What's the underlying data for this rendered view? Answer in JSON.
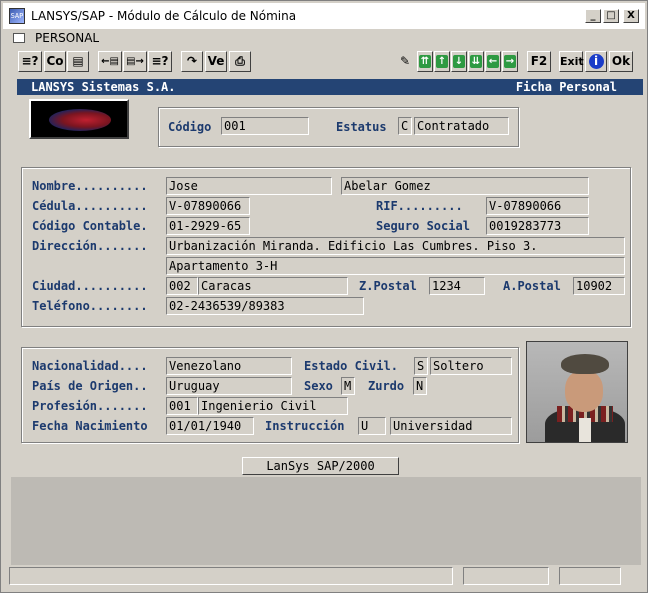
{
  "window": {
    "title": "LANSYS/SAP - Módulo de Cálculo de Nómina",
    "app_icon_text": "SAP",
    "minimize": "_",
    "maximize": "□",
    "close": "X"
  },
  "menubar": {
    "label": "PERSONAL"
  },
  "toolbar": {
    "left_buttons": [
      {
        "name": "list-icon",
        "label": "≡?"
      },
      {
        "name": "copy-button",
        "label": "Co"
      },
      {
        "name": "folder-icon",
        "label": "▤"
      },
      {
        "name": "import-icon",
        "label": "←▤"
      },
      {
        "name": "export-icon",
        "label": "▤→"
      },
      {
        "name": "report-icon",
        "label": "≡?"
      },
      {
        "name": "forward-icon",
        "label": "↷"
      },
      {
        "name": "view-button",
        "label": "Ve"
      },
      {
        "name": "print-icon",
        "label": "⎙"
      }
    ],
    "right_buttons": [
      {
        "name": "clear-icon",
        "label": "✎"
      },
      {
        "name": "first-icon",
        "label": "⇈"
      },
      {
        "name": "up-icon",
        "label": "↑"
      },
      {
        "name": "down-icon",
        "label": "↓"
      },
      {
        "name": "last-icon",
        "label": "⇊"
      },
      {
        "name": "prev-icon",
        "label": "←"
      },
      {
        "name": "next-icon",
        "label": "→"
      }
    ],
    "f2": "F2",
    "exit": "Exit",
    "info": "i",
    "ok": "Ok"
  },
  "strip": {
    "company": "LANSYS Sistemas S.A.",
    "section": "Ficha Personal"
  },
  "header": {
    "codigo_label": "Código",
    "codigo": "001",
    "estatus_label": "Estatus",
    "estatus_code": "C",
    "estatus_text": "Contratado"
  },
  "personal": {
    "nombre_label": "Nombre..........",
    "nombre": "Jose",
    "apellido": "Abelar Gomez",
    "cedula_label": "Cédula..........",
    "cedula": "V-07890066",
    "rif_label": "RIF.........",
    "rif": "V-07890066",
    "codigo_contable_label": "Código Contable.",
    "codigo_contable": "01-2929-65",
    "seguro_label": "Seguro Social",
    "seguro": "0019283773",
    "direccion_label": "Dirección.......",
    "direccion1": "Urbanización Miranda. Edificio Las Cumbres. Piso 3.",
    "direccion2": "Apartamento 3-H",
    "ciudad_label": "Ciudad..........",
    "ciudad_code": "002",
    "ciudad": "Caracas",
    "zpostal_label": "Z.Postal",
    "zpostal": "1234",
    "apostal_label": "A.Postal",
    "apostal": "10902",
    "telefono_label": "Teléfono........",
    "telefono": "02-2436539/89383"
  },
  "details": {
    "nacionalidad_label": "Nacionalidad....",
    "nacionalidad": "Venezolano",
    "estado_civil_label": "Estado Civil.",
    "estado_civil_code": "S",
    "estado_civil": "Soltero",
    "pais_label": "País de Origen..",
    "pais": "Uruguay",
    "sexo_label": "Sexo",
    "sexo": "M",
    "zurdo_label": "Zurdo",
    "zurdo": "N",
    "profesion_label": "Profesión.......",
    "profesion_code": "001",
    "profesion": "Ingenierio Civil",
    "fecha_label": "Fecha Nacimiento",
    "fecha": "01/01/1940",
    "instruccion_label": "Instrucción",
    "instruccion_code": "U",
    "instruccion": "Universidad"
  },
  "footer": {
    "version": "LanSys  SAP/2000"
  }
}
